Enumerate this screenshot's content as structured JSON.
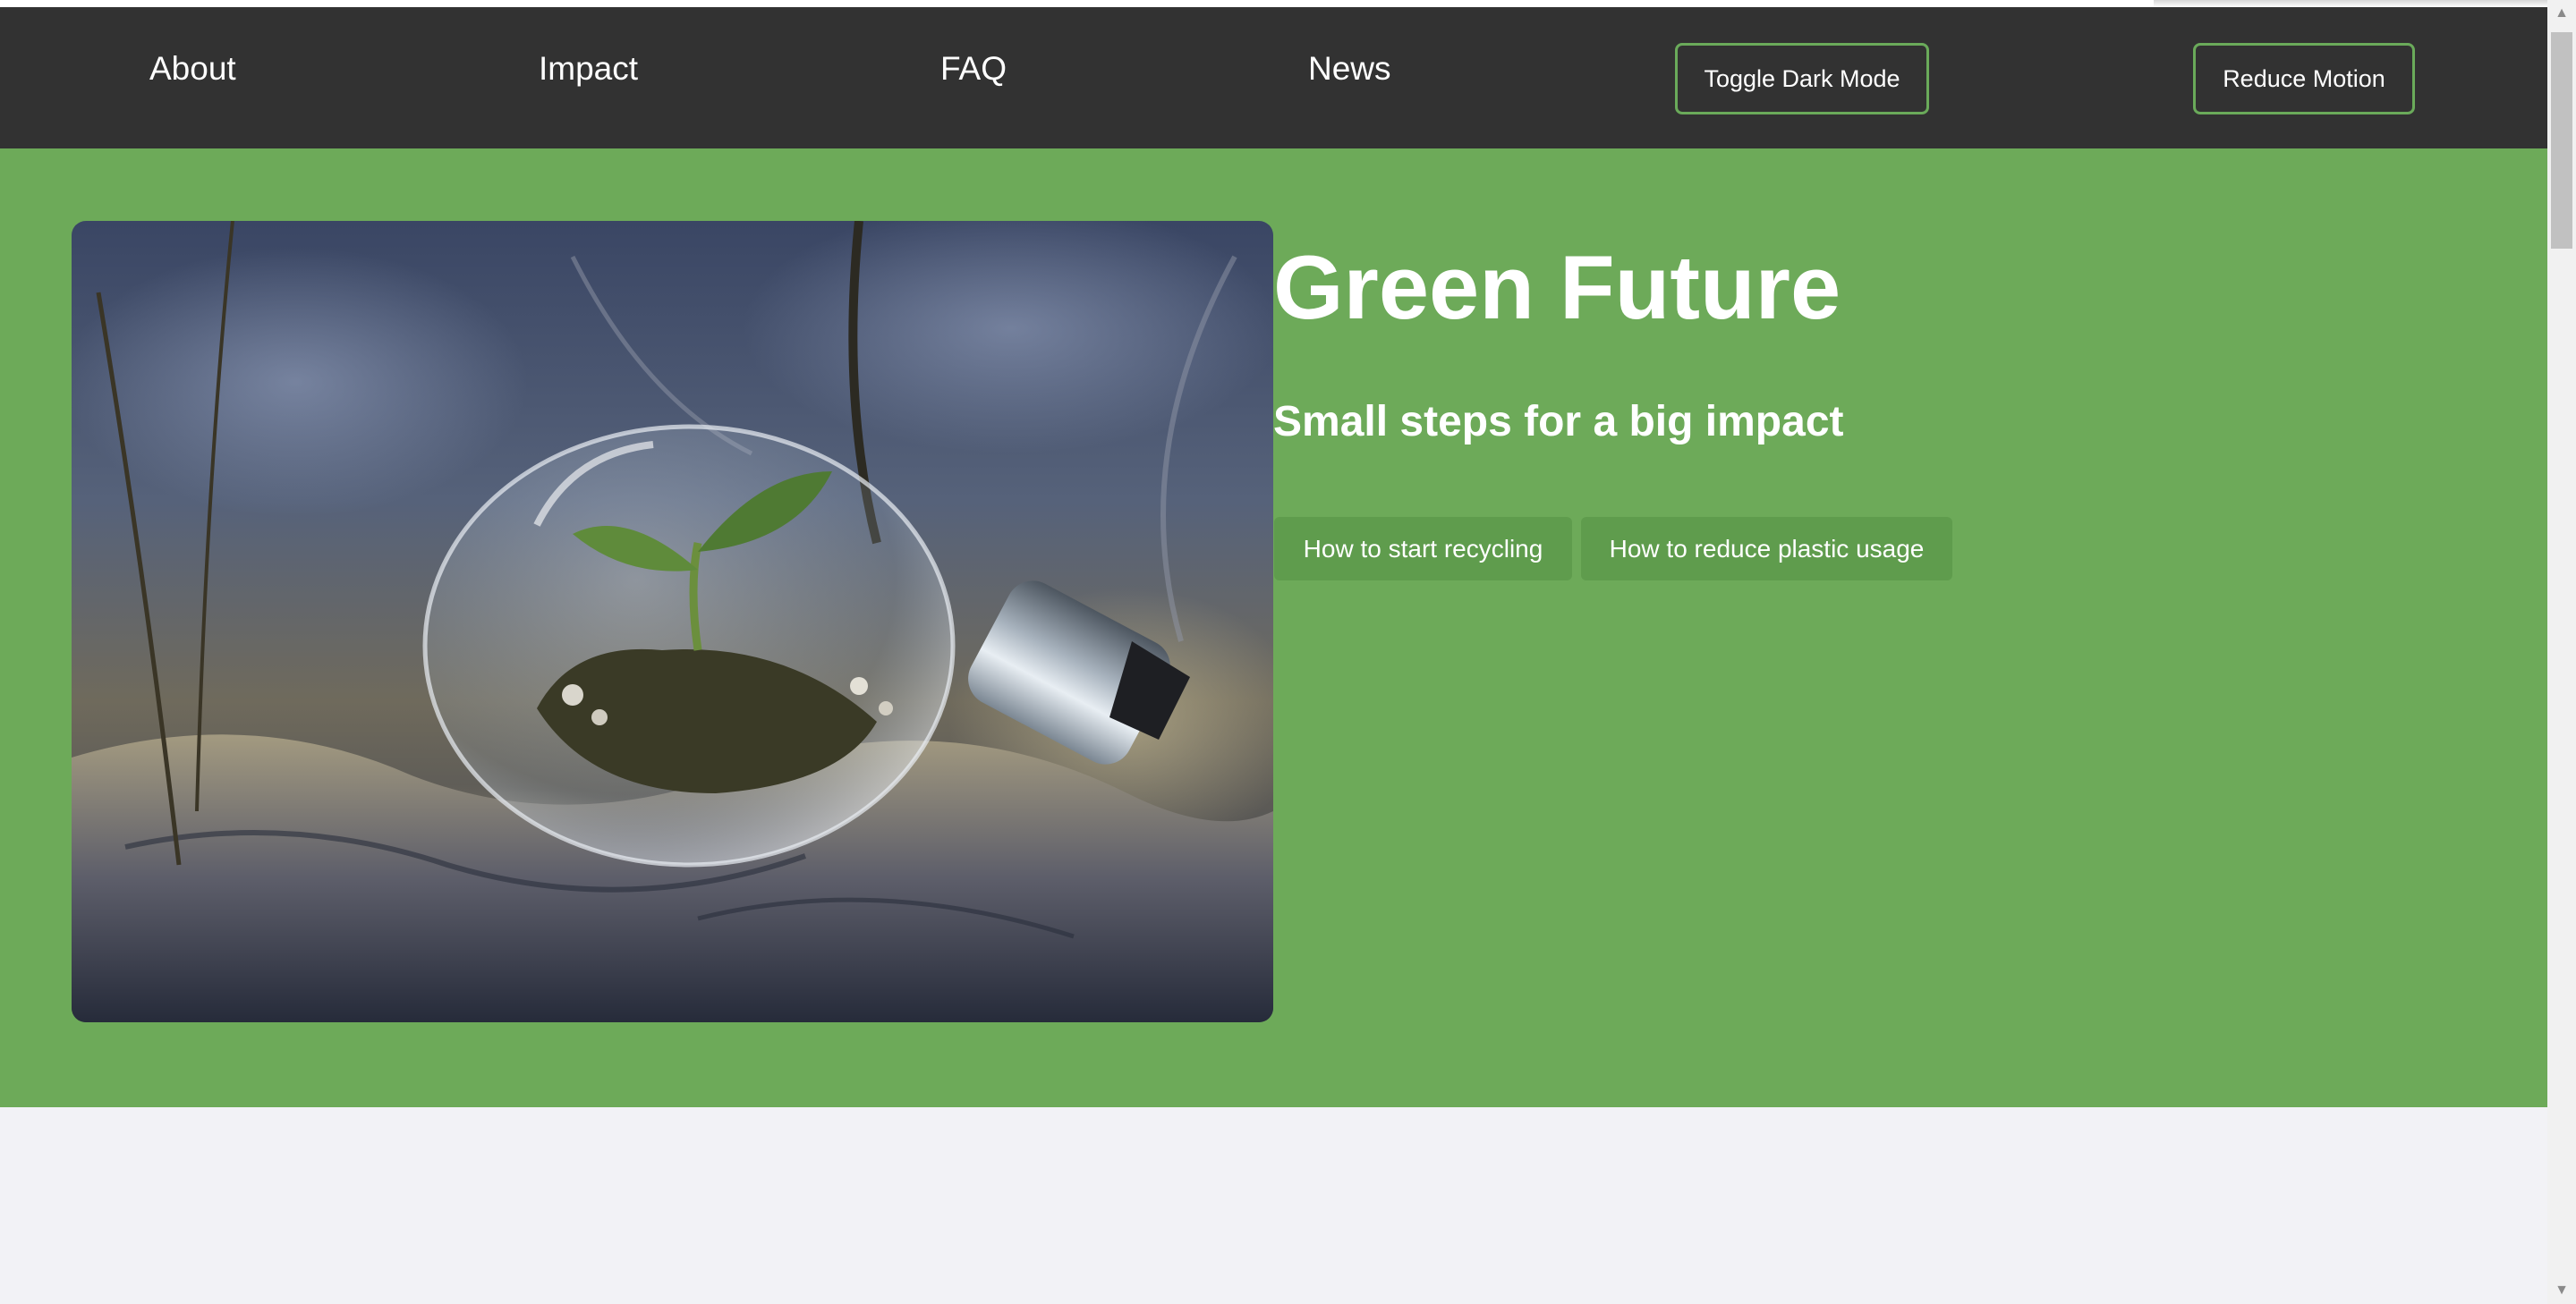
{
  "nav": {
    "links": [
      "About",
      "Impact",
      "FAQ",
      "News"
    ],
    "toggle_dark_mode": "Toggle Dark Mode",
    "reduce_motion": "Reduce Motion"
  },
  "hero": {
    "title": "Green Future",
    "subtitle": "Small steps for a big impact",
    "buttons": [
      "How to start recycling",
      "How to reduce plastic usage"
    ],
    "image_alt": "Light bulb with a seedling growing inside, lying on dry soil"
  },
  "colors": {
    "nav_bg": "#323232",
    "accent": "#6aaa5a",
    "hero_bg": "#6daa59",
    "hero_button": "#5f9c4d",
    "page_bg": "#f2f2f6"
  },
  "icons": {
    "scroll_up": "scroll-up-arrow-icon",
    "scroll_down": "scroll-down-arrow-icon"
  }
}
